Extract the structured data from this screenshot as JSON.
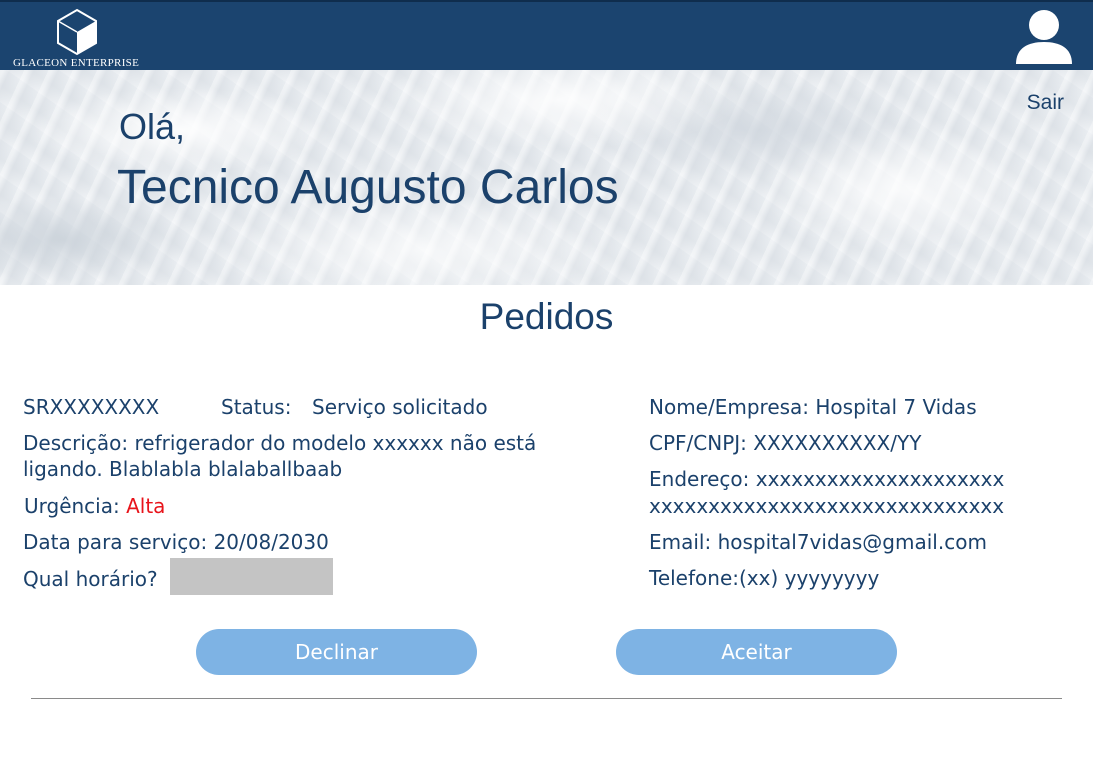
{
  "header": {
    "brand_name": "GLACEON ENTERPRISE",
    "logo_icon": "cube-icon",
    "profile_icon": "user-avatar-icon",
    "colors": {
      "bar": "#1b446f",
      "text": "#1b416b",
      "urgent": "#e8141b",
      "button": "#7eb3e4"
    }
  },
  "hero": {
    "greeting": "Olá,",
    "technician_name": "Tecnico Augusto Carlos",
    "logout_label": "Sair"
  },
  "orders": {
    "title": "Pedidos",
    "order": {
      "id": "SRXXXXXXXX",
      "status_label": "Status:",
      "status_value": "Serviço solicitado",
      "description": "Descrição: refrigerador do modelo xxxxxx não está ligando. Blablabla blalaballbaab",
      "urgency_label": "Urgência:",
      "urgency_value": "Alta",
      "service_date": "Data para serviço: 20/08/2030",
      "time_label": "Qual horário?",
      "time_value": ""
    },
    "client": {
      "name": "Nome/Empresa: Hospital 7 Vidas",
      "document": "CPF/CNPJ: XXXXXXXXXX/YY",
      "address_line1": "Endereço: xxxxxxxxxxxxxxxxxxxxx",
      "address_line2": "xxxxxxxxxxxxxxxxxxxxxxxxxxxxxx",
      "email": "Email: hospital7vidas@gmail.com",
      "phone": "Telefone:(xx) yyyyyyyy"
    },
    "actions": {
      "decline_label": "Declinar",
      "accept_label": "Aceitar"
    }
  }
}
